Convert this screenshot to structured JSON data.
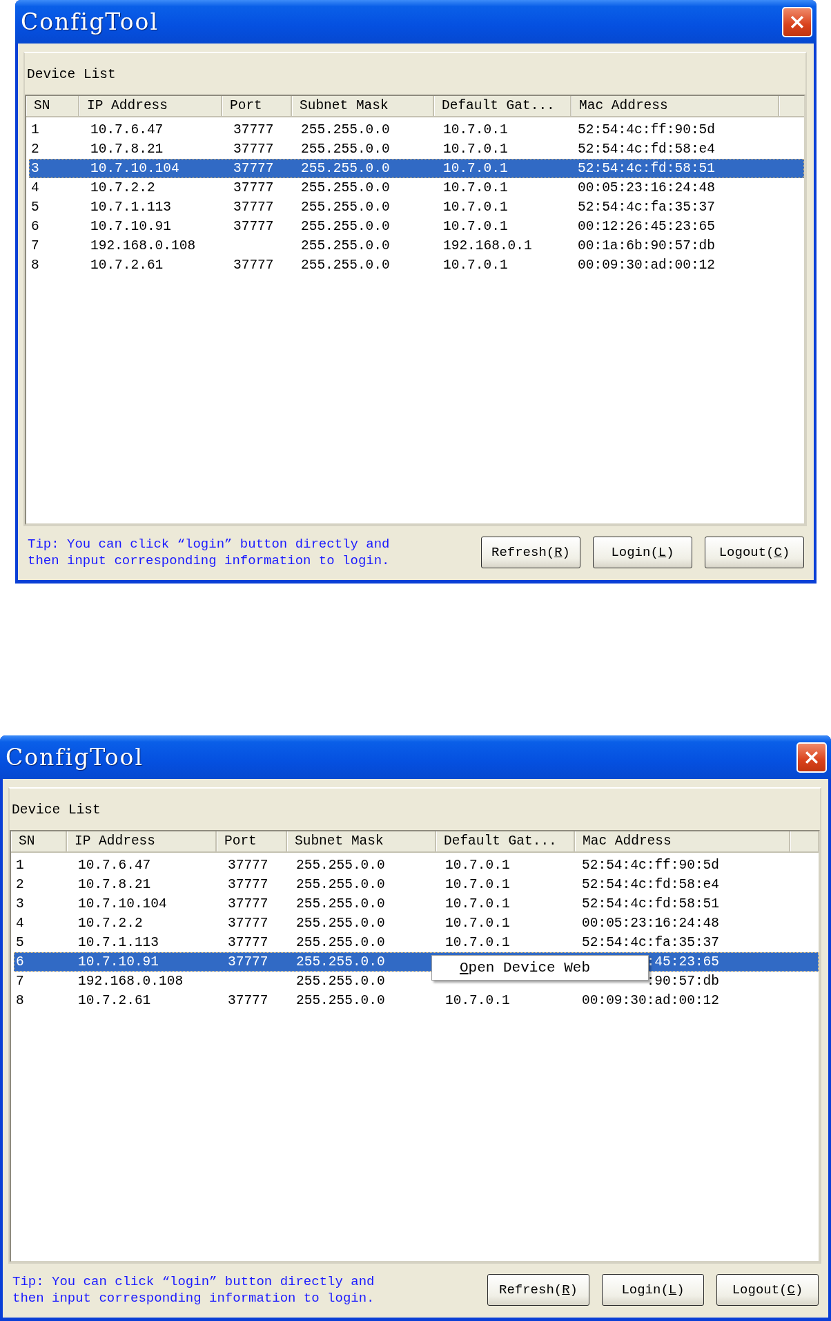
{
  "windows": [
    {
      "title": "ConfigTool",
      "group_label": "Device List",
      "columns": [
        "SN",
        "IP Address",
        "Port",
        "Subnet Mask",
        "Default Gat...",
        "Mac Address"
      ],
      "rows": [
        {
          "sn": "1",
          "ip": "10.7.6.47",
          "port": "37777",
          "mask": "255.255.0.0",
          "gateway": "10.7.0.1",
          "mac": "52:54:4c:ff:90:5d",
          "selected": false
        },
        {
          "sn": "2",
          "ip": "10.7.8.21",
          "port": "37777",
          "mask": "255.255.0.0",
          "gateway": "10.7.0.1",
          "mac": "52:54:4c:fd:58:e4",
          "selected": false
        },
        {
          "sn": "3",
          "ip": "10.7.10.104",
          "port": "37777",
          "mask": "255.255.0.0",
          "gateway": "10.7.0.1",
          "mac": "52:54:4c:fd:58:51",
          "selected": true
        },
        {
          "sn": "4",
          "ip": "10.7.2.2",
          "port": "37777",
          "mask": "255.255.0.0",
          "gateway": "10.7.0.1",
          "mac": "00:05:23:16:24:48",
          "selected": false
        },
        {
          "sn": "5",
          "ip": "10.7.1.113",
          "port": "37777",
          "mask": "255.255.0.0",
          "gateway": "10.7.0.1",
          "mac": "52:54:4c:fa:35:37",
          "selected": false
        },
        {
          "sn": "6",
          "ip": "10.7.10.91",
          "port": "37777",
          "mask": "255.255.0.0",
          "gateway": "10.7.0.1",
          "mac": "00:12:26:45:23:65",
          "selected": false
        },
        {
          "sn": "7",
          "ip": "192.168.0.108",
          "mask": "255.255.0.0",
          "gateway": "192.168.0.1",
          "mac": "00:1a:6b:90:57:db",
          "selected": false
        },
        {
          "sn": "8",
          "ip": "10.7.2.61",
          "port": "37777",
          "mask": "255.255.0.0",
          "gateway": "10.7.0.1",
          "mac": "00:09:30:ad:00:12",
          "selected": false
        }
      ],
      "tip": "Tip: You can click “login” button directly and then input corresponding information to login.",
      "buttons": [
        {
          "before": "Refresh(",
          "key": "R",
          "after": ")"
        },
        {
          "before": "Login(",
          "key": "L",
          "after": ")"
        },
        {
          "before": "Logout(",
          "key": "C",
          "after": ")"
        }
      ]
    },
    {
      "title": "ConfigTool",
      "group_label": "Device List",
      "columns": [
        "SN",
        "IP Address",
        "Port",
        "Subnet Mask",
        "Default Gat...",
        "Mac Address"
      ],
      "rows": [
        {
          "sn": "1",
          "ip": "10.7.6.47",
          "port": "37777",
          "mask": "255.255.0.0",
          "gateway": "10.7.0.1",
          "mac": "52:54:4c:ff:90:5d",
          "selected": false
        },
        {
          "sn": "2",
          "ip": "10.7.8.21",
          "port": "37777",
          "mask": "255.255.0.0",
          "gateway": "10.7.0.1",
          "mac": "52:54:4c:fd:58:e4",
          "selected": false
        },
        {
          "sn": "3",
          "ip": "10.7.10.104",
          "port": "37777",
          "mask": "255.255.0.0",
          "gateway": "10.7.0.1",
          "mac": "52:54:4c:fd:58:51",
          "selected": false
        },
        {
          "sn": "4",
          "ip": "10.7.2.2",
          "port": "37777",
          "mask": "255.255.0.0",
          "gateway": "10.7.0.1",
          "mac": "00:05:23:16:24:48",
          "selected": false
        },
        {
          "sn": "5",
          "ip": "10.7.1.113",
          "port": "37777",
          "mask": "255.255.0.0",
          "gateway": "10.7.0.1",
          "mac": "52:54:4c:fa:35:37",
          "selected": false
        },
        {
          "sn": "6",
          "ip": "10.7.10.91",
          "port": "37777",
          "mask": "255.255.0.0",
          "mac": ":45:23:65",
          "selected": true
        },
        {
          "sn": "7",
          "ip": "192.168.0.108",
          "mask": "255.255.0.0",
          "mac": ":90:57:db",
          "selected": false
        },
        {
          "sn": "8",
          "ip": "10.7.2.61",
          "port": "37777",
          "mask": "255.255.0.0",
          "gateway": "10.7.0.1",
          "mac": "00:09:30:ad:00:12",
          "selected": false
        }
      ],
      "context_menu": [
        {
          "key": "O",
          "after": "pen Device Web"
        }
      ],
      "tip": "Tip: You can click “login” button directly and then input corresponding information to login.",
      "buttons": [
        {
          "before": "Refresh(",
          "key": "R",
          "after": ")"
        },
        {
          "before": "Login(",
          "key": "L",
          "after": ")"
        },
        {
          "before": "Logout(",
          "key": "C",
          "after": ")"
        }
      ]
    }
  ]
}
